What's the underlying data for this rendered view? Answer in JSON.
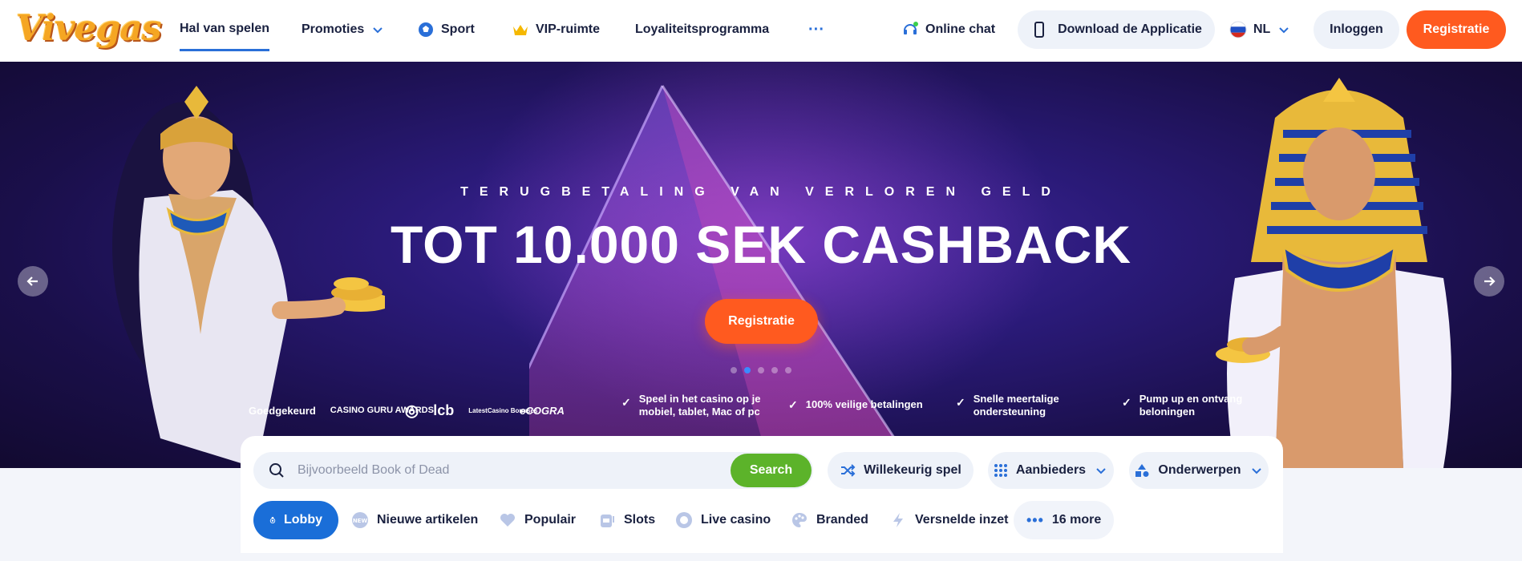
{
  "header": {
    "logo_text": "Vivegas",
    "nav": [
      {
        "label": "Hal van spelen",
        "icon": "",
        "active": true
      },
      {
        "label": "Promoties",
        "icon": "chevron-down-icon"
      },
      {
        "label": "Sport",
        "icon": "soccer-ball-icon"
      },
      {
        "label": "VIP-ruimte",
        "icon": "crown-icon"
      },
      {
        "label": "Loyaliteitsprogramma",
        "icon": ""
      },
      {
        "label": "···",
        "icon": "more-icon"
      }
    ],
    "online_chat": "Online chat",
    "download_app": "Download de Applicatie",
    "language": "NL",
    "login": "Inloggen",
    "register": "Registratie"
  },
  "hero": {
    "subtitle": "TERUGBETALING VAN VERLOREN GELD",
    "headline": "TOT 10.000 SEK CASHBACK",
    "cta": "Registratie",
    "slides_total": 5,
    "active_slide": 2,
    "approved_label": "Goedgekeurd",
    "award_logos": [
      "CASINO GURU AWARDS",
      "lcb",
      "LatestCasino Bonuses",
      "eCOGRA"
    ],
    "features": [
      {
        "line1": "Speel in het casino op je",
        "line2": "mobiel, tablet, Mac of pc"
      },
      {
        "line1": "100% veilige betalingen",
        "line2": ""
      },
      {
        "line1": "Snelle meertalige",
        "line2": "ondersteuning"
      },
      {
        "line1": "Pump up en ontvang",
        "line2": "beloningen"
      }
    ]
  },
  "search": {
    "placeholder": "Bijvoorbeeld Book of Dead",
    "button": "Search",
    "random_game": "Willekeurig spel",
    "providers": "Aanbieders",
    "topics": "Onderwerpen"
  },
  "categories": [
    {
      "label": "Lobby",
      "icon": "lobby-icon",
      "active": true
    },
    {
      "label": "Nieuwe artikelen",
      "icon": "new-badge-icon"
    },
    {
      "label": "Populair",
      "icon": "heart-icon"
    },
    {
      "label": "Slots",
      "icon": "slot-machine-icon"
    },
    {
      "label": "Live casino",
      "icon": "casino-chip-icon"
    },
    {
      "label": "Branded",
      "icon": "palette-icon"
    },
    {
      "label": "Versnelde inzet",
      "icon": "lightning-icon"
    },
    {
      "label": "16 more",
      "icon": "more-icon"
    }
  ],
  "colors": {
    "accent_orange": "#ff5a1f",
    "accent_blue": "#1a6ed8",
    "search_green": "#5cb32a",
    "text_dark": "#1a2140"
  }
}
